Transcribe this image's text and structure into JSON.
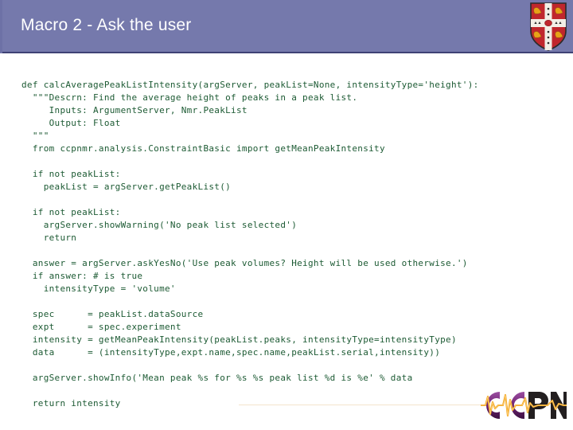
{
  "header": {
    "title": "Macro 2 - Ask the user",
    "background_color": "#7579ac",
    "title_color": "#ffffff",
    "crest_name": "university-of-cambridge-coat-of-arms"
  },
  "code": {
    "language": "python",
    "text_color": "#1c5a33",
    "lines": [
      "def calcAveragePeakListIntensity(argServer, peakList=None, intensityType='height'):",
      "  \"\"\"Descrn: Find the average height of peaks in a peak list.",
      "     Inputs: ArgumentServer, Nmr.PeakList",
      "     Output: Float",
      "  \"\"\"",
      "  from ccpnmr.analysis.ConstraintBasic import getMeanPeakIntensity",
      "",
      "  if not peakList:",
      "    peakList = argServer.getPeakList()",
      "",
      "  if not peakList:",
      "    argServer.showWarning('No peak list selected')",
      "    return",
      "",
      "  answer = argServer.askYesNo('Use peak volumes? Height will be used otherwise.')",
      "  if answer: # is true",
      "    intensityType = 'volume'",
      "",
      "  spec      = peakList.dataSource",
      "  expt      = spec.experiment",
      "  intensity = getMeanPeakIntensity(peakList.peaks, intensityType=intensityType)",
      "  data      = (intensityType,expt.name,spec.name,peakList.serial,intensity))",
      "",
      "  argServer.showInfo('Mean peak %s for %s %s peak list %d is %e' % data",
      "",
      "  return intensity"
    ]
  },
  "footer": {
    "logo_text": "CCPN",
    "logo_colors": {
      "purple": "#7b2d7e",
      "dark": "#231f20",
      "wave": "#f0a31e"
    }
  }
}
